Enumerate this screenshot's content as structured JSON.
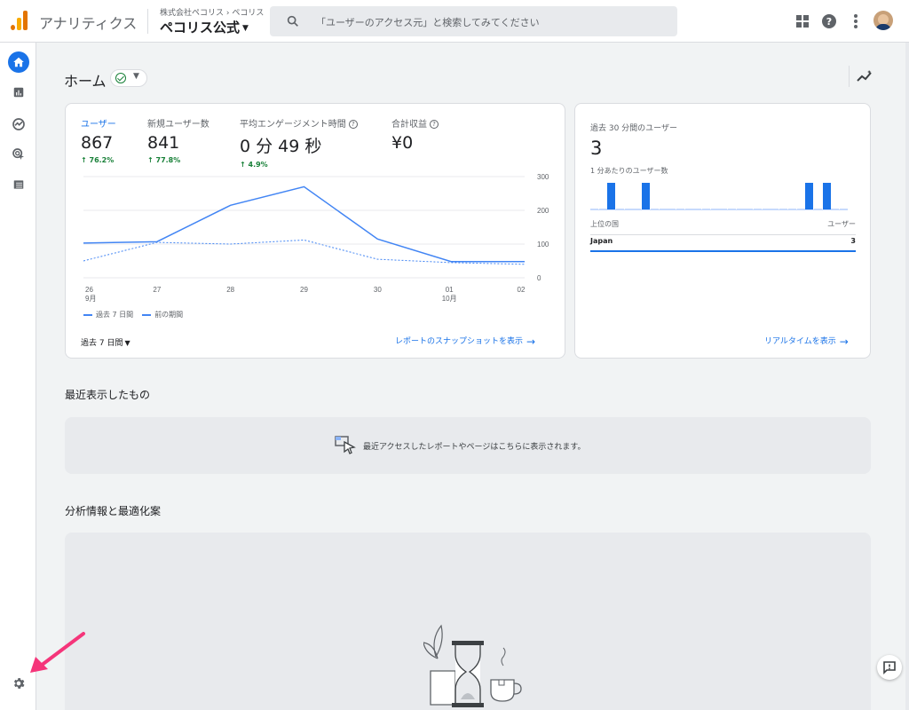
{
  "header": {
    "app_title": "アナリティクス",
    "breadcrumb": "株式会社ペコリス › ペコリス",
    "property": "ペコリス公式",
    "search_placeholder": "「ユーザーのアクセス元」と検索してみてください"
  },
  "page": {
    "title": "ホーム"
  },
  "metrics": [
    {
      "label": "ユーザー",
      "value": "867",
      "change": "76.2%"
    },
    {
      "label": "新規ユーザー数",
      "value": "841",
      "change": "77.8%"
    },
    {
      "label": "平均エンゲージメント時間",
      "value": "0 分 49 秒",
      "change": "4.9%"
    },
    {
      "label": "合計収益",
      "value": "¥0",
      "change": ""
    }
  ],
  "chart_data": {
    "type": "line",
    "categories": [
      "26\n9月",
      "27",
      "28",
      "29",
      "30",
      "01\n10月",
      "02"
    ],
    "series": [
      {
        "name": "過去 7 日間",
        "style": "solid",
        "values": [
          103,
          107,
          215,
          270,
          115,
          48,
          48
        ]
      },
      {
        "name": "前の期間",
        "style": "dashed",
        "values": [
          50,
          105,
          100,
          112,
          55,
          45,
          40
        ]
      }
    ],
    "ylim": [
      0,
      300
    ],
    "yticks": [
      "300",
      "200",
      "100",
      "0"
    ],
    "color": "#4285f4"
  },
  "legend": {
    "current": "過去 7 日間",
    "previous": "前の期間"
  },
  "main_card": {
    "range_label": "過去 7 日間",
    "snapshot_link": "レポートのスナップショットを表示"
  },
  "realtime": {
    "title": "過去 30 分間のユーザー",
    "value": "3",
    "per_minute": "1 分あたりのユーザー数",
    "bars": [
      0,
      0,
      1,
      0,
      0,
      0,
      1,
      0,
      0,
      0,
      0,
      0,
      0,
      0,
      0,
      0,
      0,
      0,
      0,
      0,
      0,
      0,
      0,
      0,
      0,
      1,
      0,
      1,
      0,
      0
    ],
    "table_head_left": "上位の国",
    "table_head_right": "ユーザー",
    "rows": [
      {
        "country": "Japan",
        "users": "3"
      }
    ],
    "link": "リアルタイムを表示"
  },
  "recent": {
    "title": "最近表示したもの",
    "message": "最近アクセスしたレポートやページはこちらに表示されます。"
  },
  "insights": {
    "title": "分析情報と最適化案"
  },
  "colors": {
    "accent": "#1a73e8",
    "positive": "#188038",
    "annotation_arrow": "#f5357a"
  }
}
